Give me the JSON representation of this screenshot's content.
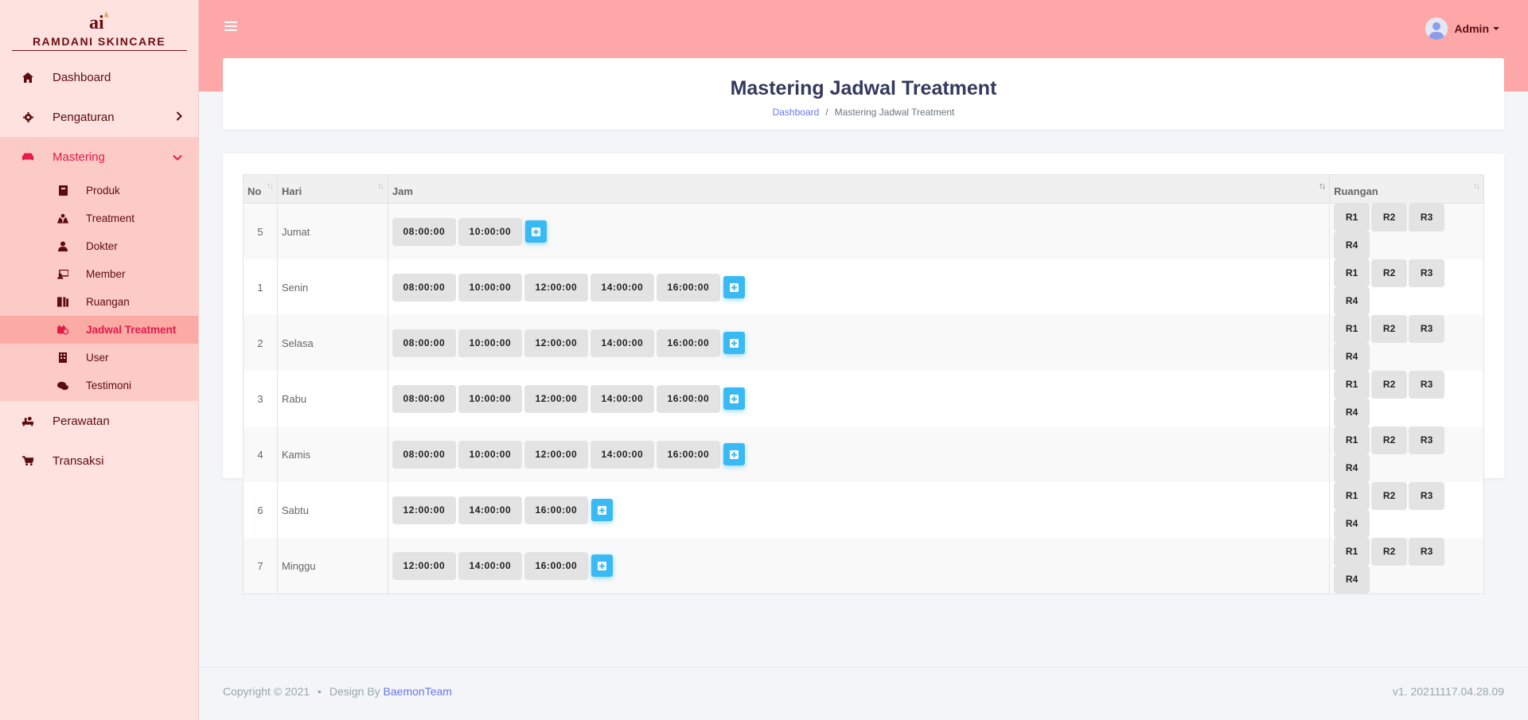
{
  "brand": {
    "name": "RAMDANI SKINCARE"
  },
  "sidebar": {
    "items": [
      {
        "label": "Dashboard",
        "icon": "home-icon"
      },
      {
        "label": "Pengaturan",
        "icon": "gear-icon"
      },
      {
        "label": "Mastering",
        "icon": "couch-icon"
      },
      {
        "label": "Perawatan",
        "icon": "spa-icon"
      },
      {
        "label": "Transaksi",
        "icon": "cart-icon"
      }
    ],
    "sub_items": [
      {
        "label": "Produk",
        "icon": "book-icon"
      },
      {
        "label": "Treatment",
        "icon": "hands-icon"
      },
      {
        "label": "Dokter",
        "icon": "doctor-icon"
      },
      {
        "label": "Member",
        "icon": "member-icon"
      },
      {
        "label": "Ruangan",
        "icon": "door-icon"
      },
      {
        "label": "Jadwal Treatment",
        "icon": "calendar-icon"
      },
      {
        "label": "User",
        "icon": "building-icon"
      },
      {
        "label": "Testimoni",
        "icon": "comments-icon"
      }
    ]
  },
  "topbar": {
    "user": "Admin"
  },
  "header": {
    "title": "Mastering Jadwal Treatment",
    "breadcrumb_home": "Dashboard",
    "breadcrumb_sep": "/",
    "breadcrumb_current": "Mastering Jadwal Treatment"
  },
  "table": {
    "headers": {
      "no": "No",
      "hari": "Hari",
      "jam": "Jam",
      "ruangan": "Ruangan"
    },
    "rooms": [
      "R1",
      "R2",
      "R3",
      "R4"
    ],
    "rows": [
      {
        "no": "5",
        "hari": "Jumat",
        "jam": [
          "08:00:00",
          "10:00:00"
        ]
      },
      {
        "no": "1",
        "hari": "Senin",
        "jam": [
          "08:00:00",
          "10:00:00",
          "12:00:00",
          "14:00:00",
          "16:00:00"
        ]
      },
      {
        "no": "2",
        "hari": "Selasa",
        "jam": [
          "08:00:00",
          "10:00:00",
          "12:00:00",
          "14:00:00",
          "16:00:00"
        ]
      },
      {
        "no": "3",
        "hari": "Rabu",
        "jam": [
          "08:00:00",
          "10:00:00",
          "12:00:00",
          "14:00:00",
          "16:00:00"
        ]
      },
      {
        "no": "4",
        "hari": "Kamis",
        "jam": [
          "08:00:00",
          "10:00:00",
          "12:00:00",
          "14:00:00",
          "16:00:00"
        ]
      },
      {
        "no": "6",
        "hari": "Sabtu",
        "jam": [
          "12:00:00",
          "14:00:00",
          "16:00:00"
        ]
      },
      {
        "no": "7",
        "hari": "Minggu",
        "jam": [
          "12:00:00",
          "14:00:00",
          "16:00:00"
        ]
      }
    ]
  },
  "footer": {
    "copyright": "Copyright © 2021",
    "bullet": "•",
    "design_by": "Design By",
    "team": "BaemonTeam",
    "version": "v1. 20211117.04.28.09"
  },
  "colors": {
    "sidebar_bg": "#fee2df",
    "topbar_bg": "#fea7a9",
    "active": "#e6194b",
    "plus_button": "#3abaf4",
    "title": "#34395e"
  }
}
